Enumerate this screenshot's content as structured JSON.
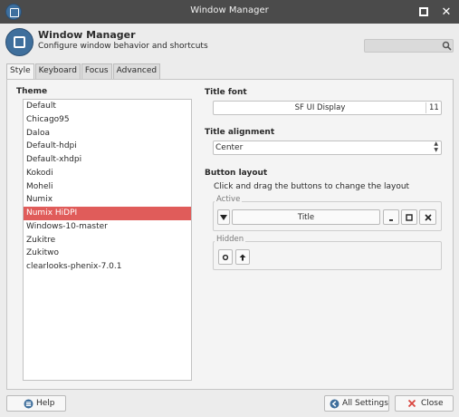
{
  "window": {
    "title": "Window Manager",
    "app_icon": "window-manager-icon",
    "maximize_icon": "maximize-icon",
    "close_icon": "close-icon"
  },
  "header": {
    "title": "Window Manager",
    "subtitle": "Configure window behavior and shortcuts",
    "search_placeholder": "",
    "search_icon": "search-icon"
  },
  "tabs": [
    {
      "label": "Style",
      "active": true
    },
    {
      "label": "Keyboard",
      "active": false
    },
    {
      "label": "Focus",
      "active": false
    },
    {
      "label": "Advanced",
      "active": false
    }
  ],
  "theme": {
    "label": "Theme",
    "items": [
      "Default",
      "Chicago95",
      "Daloa",
      "Default-hdpi",
      "Default-xhdpi",
      "Kokodi",
      "Moheli",
      "Numix",
      "Numix HiDPI",
      "Windows-10-master",
      "Zukitre",
      "Zukitwo",
      "clearlooks-phenix-7.0.1"
    ],
    "selected": "Numix HiDPI"
  },
  "title_font": {
    "label": "Title font",
    "name": "SF UI Display",
    "size": "11"
  },
  "title_alignment": {
    "label": "Title alignment",
    "value": "Center"
  },
  "button_layout": {
    "label": "Button layout",
    "hint": "Click and drag the buttons to change the layout",
    "active_label": "Active",
    "title_slot": "Title",
    "hidden_label": "Hidden"
  },
  "bottom": {
    "help": "Help",
    "all_settings": "All Settings",
    "close": "Close"
  },
  "colors": {
    "titlebar": "#4b4b4b",
    "selection": "#e05c5a",
    "icon_blue": "#3f6f9c",
    "close_red": "#d9453f"
  }
}
